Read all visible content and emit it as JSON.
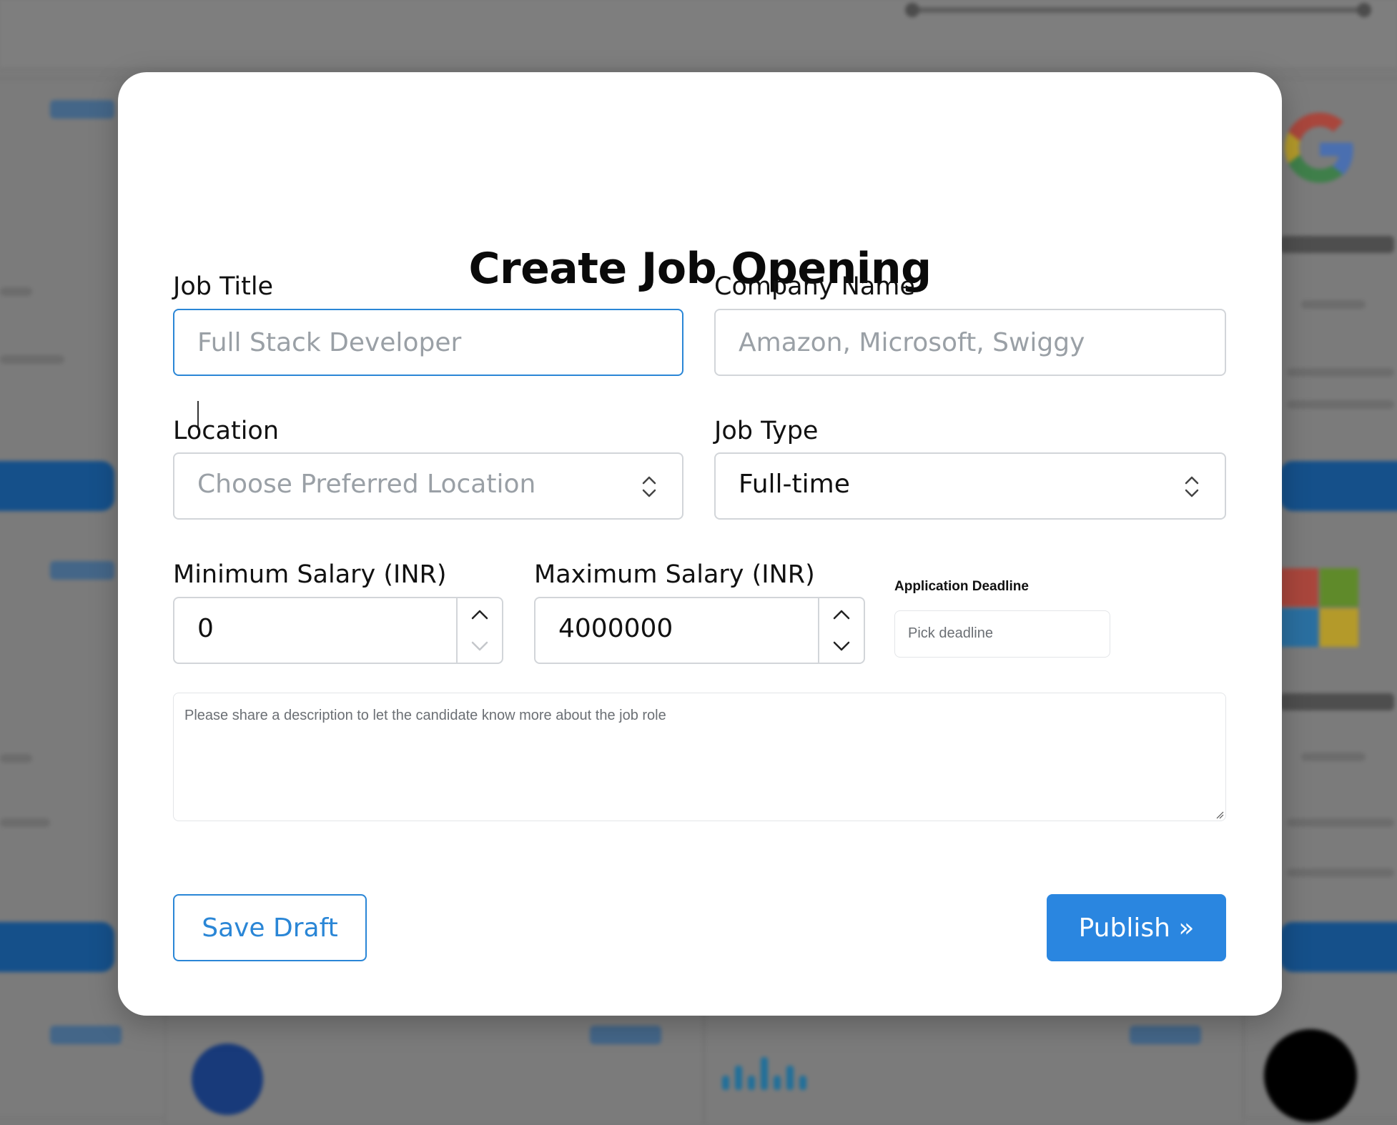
{
  "modal": {
    "title": "Create Job Opening",
    "job_title": {
      "label": "Job Title",
      "placeholder": "Full Stack Developer",
      "value": ""
    },
    "company_name": {
      "label": "Company Name",
      "placeholder": "Amazon, Microsoft, Swiggy",
      "value": ""
    },
    "location": {
      "label": "Location",
      "placeholder": "Choose Preferred Location"
    },
    "job_type": {
      "label": "Job Type",
      "selected": "Full-time"
    },
    "min_salary": {
      "label": "Minimum Salary (INR)",
      "value": "0"
    },
    "max_salary": {
      "label": "Maximum Salary (INR)",
      "value": "4000000"
    },
    "deadline": {
      "label": "Application Deadline",
      "placeholder": "Pick deadline"
    },
    "description": {
      "placeholder": "Please share a description to let the candidate know more about the job role"
    },
    "save_draft_label": "Save Draft",
    "publish_label": "Publish »"
  },
  "icons": {
    "select": "chevron-up-down-icon",
    "spinner_up": "chevron-up-icon",
    "spinner_down": "chevron-down-icon",
    "resize": "resize-handle-icon"
  },
  "colors": {
    "accent": "#2a86e0",
    "focus_border": "#2a86d6",
    "overlay": "#7a7a7a",
    "modal_bg": "#ffffff"
  }
}
